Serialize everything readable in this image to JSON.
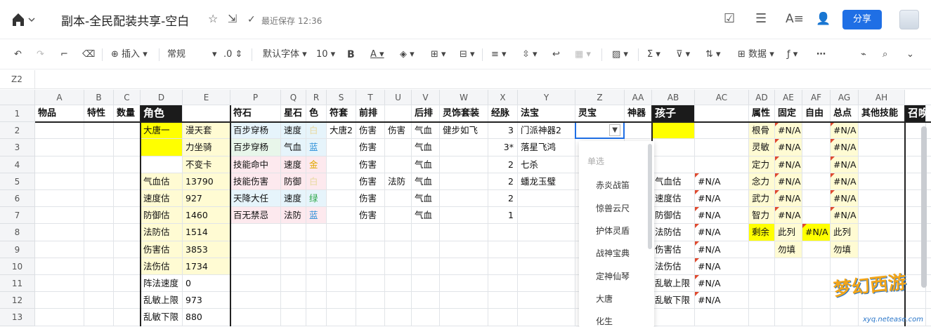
{
  "titlebar": {
    "doc_title": "副本-全民配装共享-空白",
    "save_status": "最近保存 12:36",
    "share_label": "分享"
  },
  "toolbar": {
    "insert_label": "插入",
    "format_label": "常规",
    "decimal_label": ".0",
    "font_label": "默认字体",
    "font_size": "10",
    "bold_label": "B",
    "font_color_label": "A",
    "data_label": "数据",
    "more_label": "⋯"
  },
  "formula": {
    "cell_ref": "Z2"
  },
  "colors": {
    "black_header": "#000000",
    "yellow": "#ffff00",
    "light_yellow": "#fffbd3",
    "light_blue": "#e6f4fb",
    "light_pink": "#fde9ee",
    "light_green": "#e8f6ea",
    "share_blue": "#1f6fe5"
  },
  "columns": [
    "A",
    "B",
    "C",
    "D",
    "E",
    "P",
    "Q",
    "R",
    "S",
    "T",
    "U",
    "V",
    "W",
    "X",
    "Y",
    "Z",
    "AA",
    "AB",
    "AC",
    "AD",
    "AE",
    "AF",
    "AG",
    "AH"
  ],
  "rows": [
    "1",
    "2",
    "3",
    "4",
    "5",
    "6",
    "7",
    "8",
    "9",
    "10",
    "11",
    "12",
    "13"
  ],
  "sheet": {
    "r1": {
      "A": "物品",
      "B": "特性",
      "C": "数量",
      "D": "角色",
      "P": "符石",
      "Q": "星石",
      "R": "色",
      "S": "符套",
      "T": "前排",
      "V": "后排",
      "W": "灵饰套装",
      "X": "经脉",
      "Y": "法宝",
      "Z": "灵宝",
      "AA": "神器",
      "AB": "孩子",
      "AD": "属性",
      "AE": "固定",
      "AF": "自由",
      "AG": "总点",
      "AH": "其他技能",
      "AI": "召唤"
    },
    "r2": {
      "D": "大唐一",
      "E": "漫天套",
      "P": "百步穿杨",
      "Q": "速度",
      "R": "白",
      "S": "大唐2",
      "T": "伤害",
      "U": "伤害",
      "V": "气血",
      "W": "健步如飞",
      "X": "3",
      "Y": "门派神器2",
      "AD": "根骨",
      "AE": "#N/A",
      "AG": "#N/A"
    },
    "r3": {
      "E": "力坐骑",
      "P": "百步穿杨",
      "Q": "气血",
      "R": "蓝",
      "T": "伤害",
      "V": "气血",
      "X": "3*",
      "Y": "落星飞鸿",
      "AD": "灵敏",
      "AE": "#N/A",
      "AG": "#N/A"
    },
    "r4": {
      "E": "不变卡",
      "P": "技能命中",
      "Q": "速度",
      "R": "金",
      "T": "伤害",
      "V": "气血",
      "X": "2",
      "Y": "七杀",
      "AD": "定力",
      "AE": "#N/A",
      "AG": "#N/A"
    },
    "r5": {
      "D": "气血估",
      "E": "13790",
      "P": "技能伤害",
      "Q": "防御",
      "R": "白",
      "T": "伤害",
      "U": "法防",
      "V": "气血",
      "X": "2",
      "Y": "蟠龙玉璧",
      "AB": "气血估",
      "AC": "#N/A",
      "AD": "念力",
      "AE": "#N/A",
      "AG": "#N/A"
    },
    "r6": {
      "D": "速度估",
      "E": "927",
      "P": "天降大任",
      "Q": "速度",
      "R": "绿",
      "T": "伤害",
      "V": "气血",
      "X": "2",
      "AB": "速度估",
      "AC": "#N/A",
      "AD": "武力",
      "AE": "#N/A",
      "AG": "#N/A"
    },
    "r7": {
      "D": "防御估",
      "E": "1460",
      "P": "百无禁忌",
      "Q": "法防",
      "R": "蓝",
      "T": "伤害",
      "V": "气血",
      "X": "1",
      "AB": "防御估",
      "AC": "#N/A",
      "AD": "智力",
      "AE": "#N/A",
      "AG": "#N/A"
    },
    "r8": {
      "D": "法防估",
      "E": "1514",
      "AB": "法防估",
      "AC": "#N/A",
      "AD": "剩余",
      "AE": "此列",
      "AF": "#N/A",
      "AG": "此列"
    },
    "r9": {
      "D": "伤害估",
      "E": "3853",
      "AB": "伤害估",
      "AC": "#N/A",
      "AE": "勿填",
      "AG": "勿填"
    },
    "r10": {
      "D": "法伤估",
      "E": "1734",
      "AB": "法伤估",
      "AC": "#N/A"
    },
    "r11": {
      "D": "阵法速度",
      "E": "0",
      "AB": "乱敏上限",
      "AC": "#N/A"
    },
    "r12": {
      "D": "乱敏上限",
      "E": "973",
      "AB": "乱敏下限",
      "AC": "#N/A"
    },
    "r13": {
      "D": "乱敏下限",
      "E": "880"
    }
  },
  "dropdown": {
    "caption": "单选",
    "options": [
      "赤炎战笛",
      "惊兽云尺",
      "护体灵盾",
      "战神宝典",
      "定神仙琴",
      "大唐",
      "化生"
    ]
  },
  "watermark": {
    "text": "梦幻西游",
    "sub": "xyq.netease.com"
  }
}
